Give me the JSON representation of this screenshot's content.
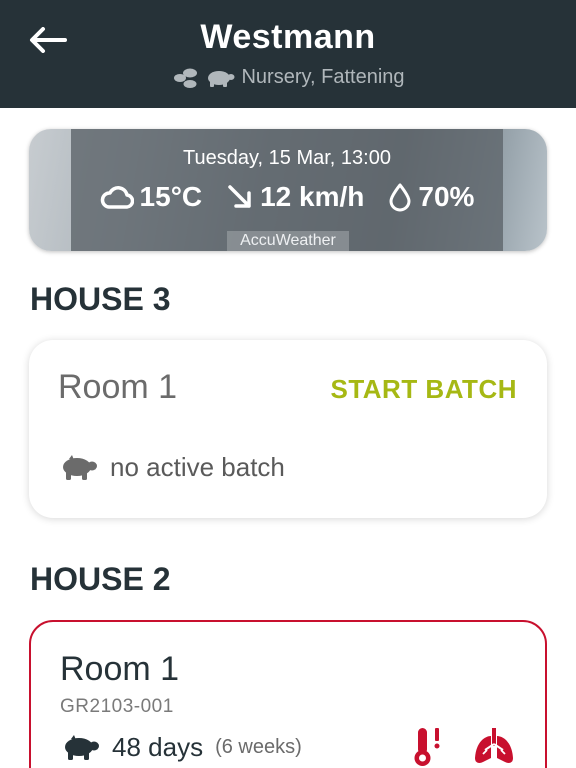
{
  "header": {
    "title": "Westmann",
    "subtitle": "Nursery, Fattening",
    "icons": [
      "back-arrow-icon",
      "piglets-icon",
      "pig-icon"
    ],
    "background": "#263238"
  },
  "weather": {
    "datetime": "Tuesday, 15 Mar, 13:00",
    "temperature": "15°C",
    "wind": "12 km/h",
    "humidity": "70%",
    "source": "AccuWeather",
    "icons": [
      "cloud-icon",
      "wind-direction-arrow-icon",
      "humidity-drop-icon"
    ]
  },
  "houses": [
    {
      "title": "HOUSE 3",
      "room": {
        "name": "Room 1",
        "action": "START BATCH",
        "status": "no active batch"
      }
    },
    {
      "title": "HOUSE 2",
      "room": {
        "name": "Room 1",
        "batch_code": "GR2103-001",
        "age_days": "48 days",
        "age_weeks": "(6 weeks)",
        "alerts": [
          "temperature-alert-icon",
          "lungs-alert-icon"
        ]
      }
    }
  ],
  "colors": {
    "accent": "#a6b814",
    "alert": "#c8102e",
    "text_dark": "#263238"
  }
}
